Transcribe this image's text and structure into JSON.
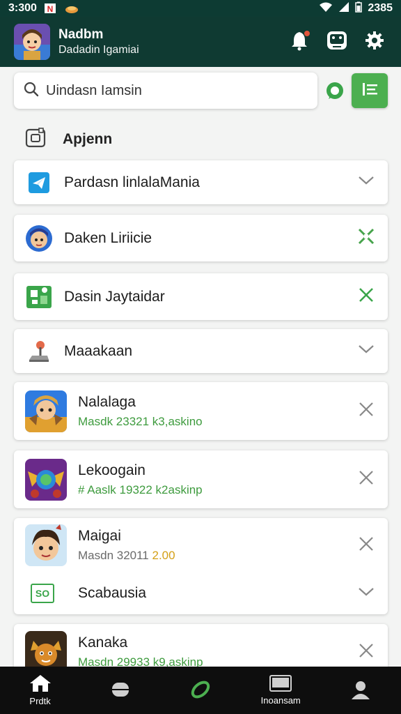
{
  "status_bar": {
    "time": "3:300",
    "right_text": "2385"
  },
  "header": {
    "title": "Nadbm",
    "subtitle": "Dadadin Igamiai",
    "icons": [
      "notification-bell-icon",
      "gamepad-icon",
      "settings-gear-icon"
    ]
  },
  "search": {
    "value": "Uindasn Iamsin"
  },
  "section": {
    "title": "Apjenn"
  },
  "rows": [
    {
      "name": "Pardasn linlalaMania",
      "action": "chevron-down"
    },
    {
      "name": "Daken Liriicie",
      "action": "close"
    },
    {
      "name": "Dasin Jaytaidar",
      "action": "close"
    },
    {
      "name": "Maaakaan",
      "action": "chevron-down"
    },
    {
      "name": "Nalalaga",
      "meta": "Masdk 23321 k3,askino",
      "action": "close"
    },
    {
      "name": "Lekoogain",
      "meta": "# Aaslk 19322 k2askinp",
      "action": "close"
    },
    {
      "name": "Maigai",
      "meta_prefix": "Masdn 32011",
      "meta_value": "2.00",
      "action": "close"
    },
    {
      "name": "Scabausia",
      "icon_text": "SO",
      "action": "chevron-down"
    },
    {
      "name": "Kanaka",
      "meta": "Masdn 29933 k9,askinp",
      "action": "close"
    }
  ],
  "bottom_nav": [
    {
      "label": "Prdtk",
      "icon": "home-icon"
    },
    {
      "label": "",
      "icon": "game-controller-icon"
    },
    {
      "label": "",
      "icon": "ring-icon"
    },
    {
      "label": "Inoansam",
      "icon": "tablet-icon"
    },
    {
      "label": "",
      "icon": "profile-icon"
    }
  ],
  "colors": {
    "header_bg": "#0f3a32",
    "accent_green": "#4caf50",
    "meta_green": "#3e9b3e",
    "gold": "#d4a017",
    "nav_bg": "#0e0e0e"
  }
}
